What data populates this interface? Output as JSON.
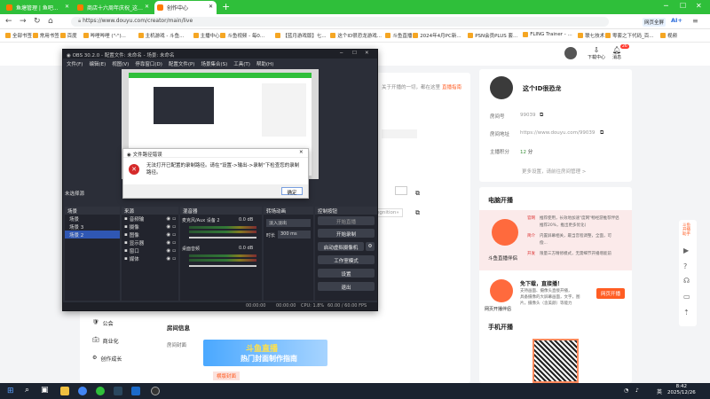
{
  "browser": {
    "tabs": [
      {
        "label": "鱼塘管理 | 鱼吧...",
        "active": false
      },
      {
        "label": "商店十六周年庆祝_这个ID很恐...",
        "active": false
      },
      {
        "label": "创作中心",
        "active": true
      }
    ],
    "new_tab": "+",
    "url": "https://www.douyu.com/creator/main/live",
    "right_tools": {
      "fullscreen": "网页全屏",
      "ai": "AI+"
    },
    "bookmarks": [
      "全部书签",
      "常用书签",
      "百度",
      "哔哩哔哩 (\"-\")...",
      "主机游戏 - 斗鱼...",
      "主播中心",
      "斗鱼视频 - 每0...",
      "【蓝月游戏版】七...",
      "这个ID很恐龙游戏...",
      "斗鱼直播",
      "2024年4月PC新...",
      "PSN会员PLUS 套...",
      "FLING Trainer - ...",
      "联七技术",
      "零套之下代码_百...",
      "视频"
    ]
  },
  "douyu": {
    "header_actions": {
      "download": "下载中心",
      "messages": "消息",
      "msg_count": "26"
    },
    "left_nav": [
      {
        "label": "公会",
        "icon": "guild-icon"
      },
      {
        "label": "商业化",
        "icon": "business-icon"
      },
      {
        "label": "创作成长",
        "icon": "growth-icon"
      }
    ],
    "notice_fragment": "关于开播的一切，都在这里",
    "live_guide": "直播指南",
    "recognition_hint": "ognition»",
    "room_info": {
      "title": "房间信息",
      "cover_label": "房间封面",
      "cover_banner_line1": "斗鱼直播",
      "cover_banner_line2": "热门封面制作指南",
      "cover_caption": "横版封面"
    },
    "streamer": {
      "name": "这个ID很恐龙",
      "room_no_label": "房间号",
      "room_no": "99039",
      "room_addr_label": "房间地址",
      "room_addr": "https://www.douyu.com/99039",
      "points_label": "主播积分",
      "points": "12",
      "points_unit": "分",
      "more": "更多设置，请前往房间管理",
      "more_arrow": ">"
    },
    "pc_live": {
      "title": "电脑开播",
      "app_name": "斗鱼直播伴侣",
      "tags": [
        "官网",
        "简介",
        "开发"
      ],
      "lines": [
        "推荐使用，长效地加速\"度网\"畅经游推荐伴侣",
        "推荐20%，推出更多优化(",
        "内置屏幕相关，最当音程调整，全面，可",
        "偿...",
        "限量三方精修模式，无需细节开播增能前"
      ]
    },
    "web_live": {
      "title": "网页开播伴侣",
      "heading": "免下载，直接播！",
      "desc": [
        "支持画面、摄像头直接开播，",
        "具备摄像的大屏幕画面，文字，图",
        "片，摄像头（含美颜）等能力"
      ],
      "button": "网页开播"
    },
    "mobile_live": {
      "title": "手机开播"
    },
    "right_float": [
      "斗鱼",
      "开播",
      "助手"
    ]
  },
  "obs": {
    "title": "OBS 30.2.0 - 配置文件: 未命名 - 场景: 未命名",
    "menu": [
      "文件(F)",
      "编辑(E)",
      "视图(V)",
      "停靠窗口(D)",
      "配置文件(P)",
      "场景集合(S)",
      "工具(T)",
      "帮助(H)"
    ],
    "no_source": "未选择源",
    "panels": {
      "scenes": "场景",
      "sources": "来源",
      "mixer": "混音器",
      "transitions": "转场动画",
      "controls": "控制按钮"
    },
    "scenes": [
      "场景",
      "场景 3",
      "场景 2"
    ],
    "selected_scene": 2,
    "sources": [
      "音频输",
      "摄像",
      "图像",
      "显示器",
      "窗口",
      "媒体"
    ],
    "mixer": [
      {
        "name": "麦克风/Aux 设备 2",
        "db": "0.0 dB"
      },
      {
        "name": "桌面音频",
        "db": "0.0 dB"
      }
    ],
    "transition": {
      "type": "淡入淡出",
      "duration_label": "时长",
      "duration": "300 ms"
    },
    "controls": [
      "开始直播",
      "开始录制",
      "启动虚拟摄像机",
      "工作室模式",
      "设置",
      "退出"
    ],
    "status": {
      "rec": "00:00:00",
      "live": "00:00:00",
      "cpu": "CPU: 1.8%",
      "fps": "60.00 / 60.00 FPS"
    }
  },
  "dialog": {
    "title": "文件路径错误",
    "message": "无法打开已配置的录制路径。请在\"设置->输出->录制\"下检查您的录制路径。",
    "ok": "确定"
  },
  "taskbar": {
    "time": "8:42",
    "date": "2025/12/26",
    "lang": "英",
    "search_icon": "search-icon"
  }
}
